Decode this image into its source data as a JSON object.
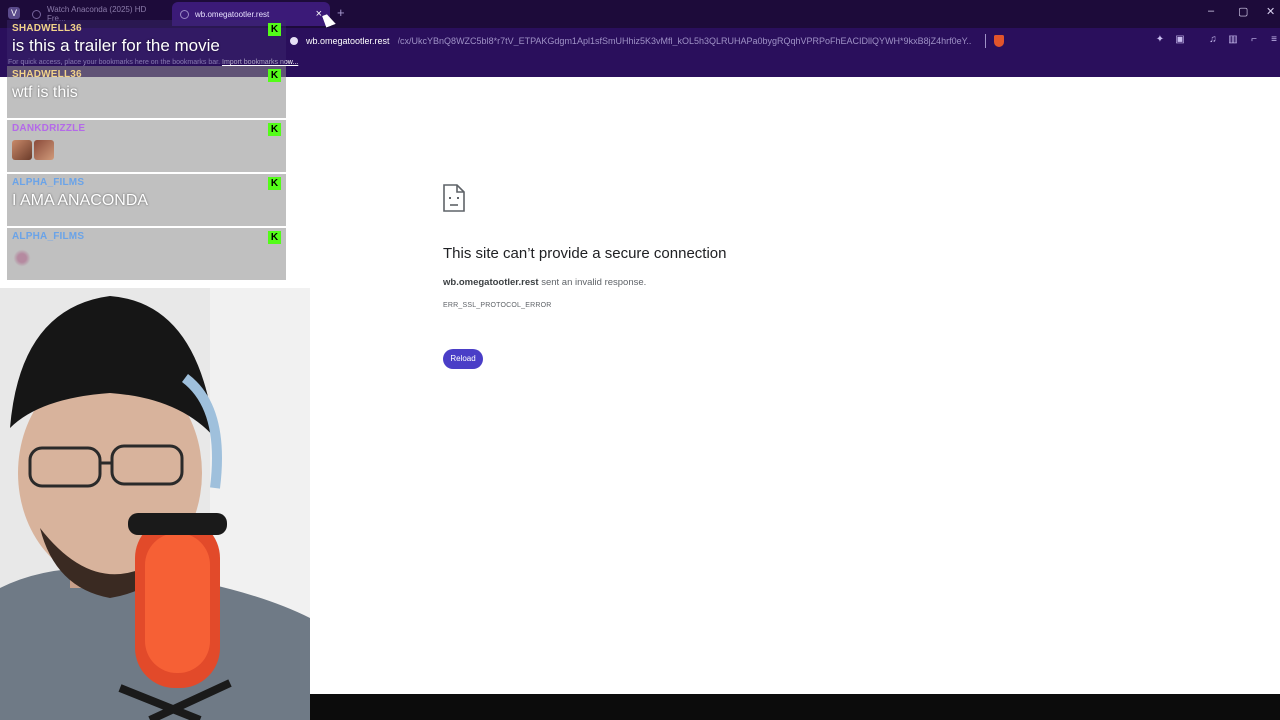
{
  "browser": {
    "tabs": [
      {
        "title": "Watch Anaconda (2025) HD Fre..."
      },
      {
        "title": "wb.omegatootler.rest"
      }
    ],
    "new_tab_symbol": "+",
    "close_symbol": "×",
    "window_controls": [
      "–",
      "▢",
      "✕"
    ],
    "url_host": "wb.omegatootler.rest",
    "url_path": "/cx/UkcYBnQ8WZC5bl8*r7tV_ETPAKGdgm1Apl1sfSmUHhiz5K3vMfl_kOL5h3QLRUHAPa0bygRQqhVPRPoFhEACIDllQYWH*9kxB8jZ4hrf0eY...",
    "bookmarks_bar": {
      "hint": "For quick access, place your bookmarks here on the bookmarks bar.",
      "import_link": "Import bookmarks now..."
    },
    "toolbar_icons": [
      "puzzle-icon",
      "wallet-icon",
      "music-icon",
      "sidebar-icon",
      "glasses-icon",
      "menu-icon"
    ]
  },
  "error_page": {
    "title": "This site can’t provide a secure connection",
    "host": "wb.omegatootler.rest",
    "description": " sent an invalid response.",
    "code": "ERR_SSL_PROTOCOL_ERROR",
    "reload_label": "Reload"
  },
  "chat": {
    "messages": [
      {
        "user": "SHADWELL36",
        "user_color": "#f2d38a",
        "text": "is this a trailer for the movie"
      },
      {
        "user": "SHADWELL36",
        "user_color": "#f2d38a",
        "text": "wtf is this"
      },
      {
        "user": "DANKDRIZZLE",
        "user_color": "#b46ae8",
        "text": ""
      },
      {
        "user": "ALPHA_FILMS",
        "user_color": "#6aa3e8",
        "text": "I AMA ANACONDA"
      },
      {
        "user": "ALPHA_FILMS",
        "user_color": "#6aa3e8",
        "text": ""
      }
    ],
    "badge_letter": "K"
  },
  "colors": {
    "tabbar": "#1d0b3a",
    "toolbar": "#2a0f5c",
    "reload_button": "#4a3ec7",
    "kick_green": "#53fc18"
  }
}
